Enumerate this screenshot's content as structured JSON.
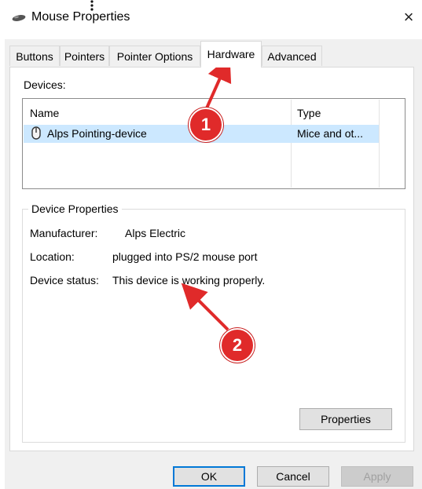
{
  "window": {
    "title": "Mouse Properties",
    "close_glyph": "×"
  },
  "tabs": [
    {
      "label": "Buttons",
      "active": false
    },
    {
      "label": "Pointers",
      "active": false
    },
    {
      "label": "Pointer Options",
      "active": false
    },
    {
      "label": "Hardware",
      "active": true
    },
    {
      "label": "Advanced",
      "active": false
    }
  ],
  "devices": {
    "label": "Devices:",
    "columns": [
      "Name",
      "Type"
    ],
    "rows": [
      {
        "name": "Alps Pointing-device",
        "type": "Mice and ot...",
        "selected": true,
        "icon": "mouse-icon"
      }
    ]
  },
  "device_properties": {
    "title": "Device Properties",
    "manufacturer_label": "Manufacturer:",
    "manufacturer_value": "Alps Electric",
    "location_label": "Location:",
    "location_value": "plugged into PS/2 mouse port",
    "status_label": "Device status:",
    "status_value": "This device is working properly.",
    "properties_button": "Properties"
  },
  "footer": {
    "ok_label": "OK",
    "cancel_label": "Cancel",
    "apply_label": "Apply"
  },
  "annotations": {
    "badge_1": "1",
    "badge_2": "2",
    "color": "#e02a2a"
  },
  "colors": {
    "selection": "#cce8ff",
    "default_button_border": "#0078d7"
  }
}
